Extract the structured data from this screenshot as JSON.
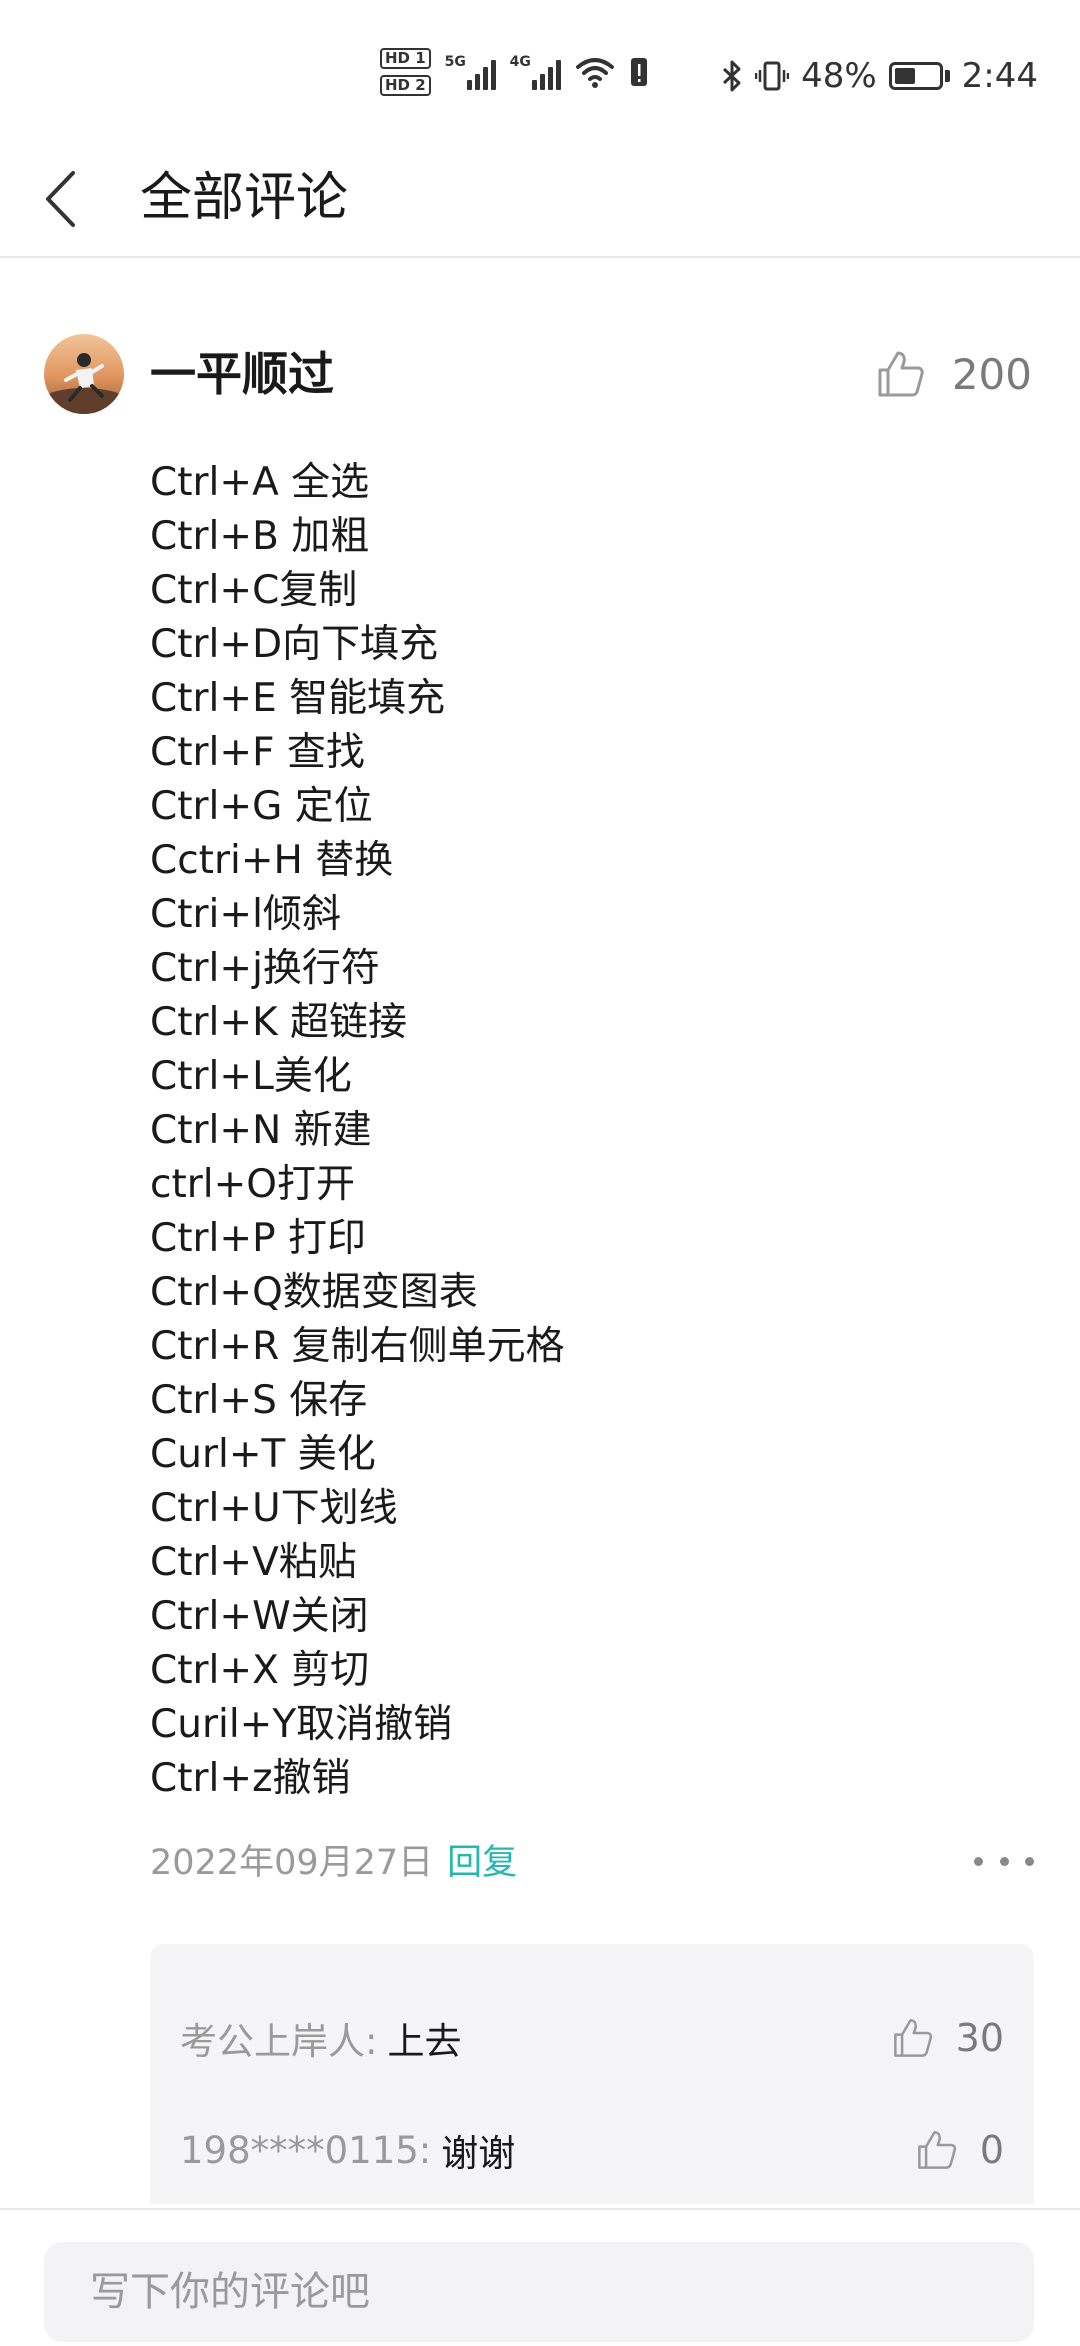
{
  "status_bar": {
    "hd1": "HD 1",
    "hd2": "HD 2",
    "sim1_gen": "5G",
    "sim2_gen": "4G",
    "battery_percent": "48%",
    "battery_level": 0.48,
    "time": "2:44"
  },
  "header": {
    "title": "全部评论"
  },
  "comment": {
    "username": "一平顺过",
    "like_count": "200",
    "lines": [
      "Ctrl+A 全选",
      "Ctrl+B 加粗",
      "Ctrl+C复制",
      "Ctrl+D向下填充",
      "Ctrl+E 智能填充",
      "Ctrl+F 查找",
      "Ctrl+G 定位",
      "Cctri+H 替换",
      "Ctri+l倾斜",
      "Ctrl+j换行符",
      "Ctrl+K 超链接",
      "Ctrl+L美化",
      "Ctrl+N 新建",
      "ctrl+O打开",
      "Ctrl+P 打印",
      "Ctrl+Q数据变图表",
      "Ctrl+R 复制右侧单元格",
      "Ctrl+S 保存",
      "Curl+T 美化",
      "Ctrl+U下划线",
      "Ctrl+V粘贴",
      "Ctrl+W关闭",
      "Ctrl+X 剪切",
      "Curil+Y取消撤销",
      "Ctrl+z撤销"
    ],
    "date": "2022年09月27日",
    "reply_label": "回复"
  },
  "replies": [
    {
      "user": "考公上岸人:",
      "text": "上去",
      "like_count": "30"
    },
    {
      "user": "198****0115:",
      "text": "谢谢",
      "like_count": "0"
    }
  ],
  "bottom": {
    "input_placeholder": "写下你的评论吧"
  },
  "colors": {
    "accent": "#25b7b2",
    "muted": "#9a9a9a",
    "reply_bg": "#f5f5f7"
  }
}
